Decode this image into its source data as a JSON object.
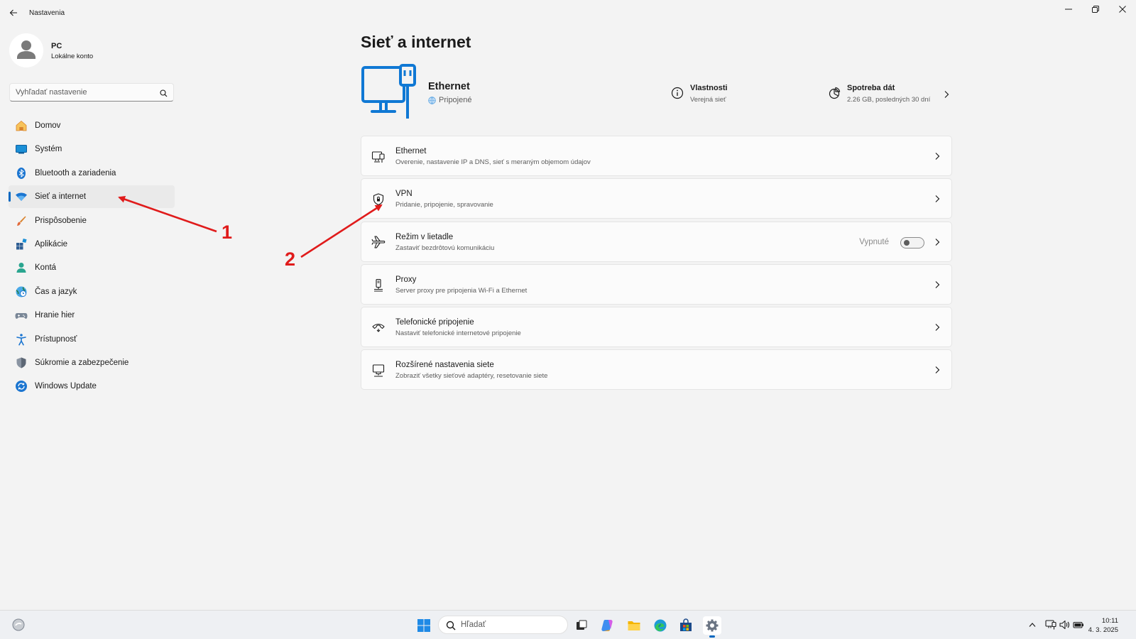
{
  "window": {
    "title": "Nastavenia",
    "controls": [
      "minimize",
      "restore",
      "close"
    ]
  },
  "profile": {
    "name": "PC",
    "account_type": "Lokálne konto"
  },
  "search": {
    "placeholder": "Vyhľadať nastavenie"
  },
  "sidebar": {
    "items": [
      {
        "label": "Domov",
        "icon": "home-icon",
        "active": false
      },
      {
        "label": "Systém",
        "icon": "system-icon",
        "active": false
      },
      {
        "label": "Bluetooth a zariadenia",
        "icon": "bluetooth-icon",
        "active": false
      },
      {
        "label": "Sieť a internet",
        "icon": "wifi-icon",
        "active": true
      },
      {
        "label": "Prispôsobenie",
        "icon": "brush-icon",
        "active": false
      },
      {
        "label": "Aplikácie",
        "icon": "apps-icon",
        "active": false
      },
      {
        "label": "Kontá",
        "icon": "account-icon",
        "active": false
      },
      {
        "label": "Čas a jazyk",
        "icon": "time-language-icon",
        "active": false
      },
      {
        "label": "Hranie hier",
        "icon": "gamepad-icon",
        "active": false
      },
      {
        "label": "Prístupnosť",
        "icon": "accessibility-icon",
        "active": false
      },
      {
        "label": "Súkromie a zabezpečenie",
        "icon": "shield-icon",
        "active": false
      },
      {
        "label": "Windows Update",
        "icon": "update-icon",
        "active": false
      }
    ]
  },
  "main": {
    "title": "Sieť a internet",
    "hero": {
      "name": "Ethernet",
      "status": "Pripojené",
      "properties_title": "Vlastnosti",
      "properties_sub": "Verejná sieť",
      "data_title": "Spotreba dát",
      "data_sub": "2.26 GB, posledných 30 dní"
    },
    "cards": [
      {
        "title": "Ethernet",
        "subtitle": "Overenie, nastavenie IP a DNS, sieť s meraným objemom údajov",
        "icon": "ethernet-icon"
      },
      {
        "title": "VPN",
        "subtitle": "Pridanie, pripojenie, spravovanie",
        "icon": "vpn-shield-icon"
      },
      {
        "title": "Režim v lietadle",
        "subtitle": "Zastaviť bezdrôtovú komunikáciu",
        "icon": "airplane-icon",
        "toggle_text": "Vypnuté",
        "toggle_on": false
      },
      {
        "title": "Proxy",
        "subtitle": "Server proxy pre pripojenia Wi-Fi a Ethernet",
        "icon": "proxy-icon"
      },
      {
        "title": "Telefonické pripojenie",
        "subtitle": "Nastaviť telefonické internetové pripojenie",
        "icon": "dialup-icon"
      },
      {
        "title": "Rozšírené nastavenia siete",
        "subtitle": "Zobraziť všetky sieťové adaptéry, resetovanie siete",
        "icon": "advanced-network-icon"
      }
    ]
  },
  "annotations": {
    "label_1": "1",
    "label_2": "2",
    "color": "#e01b1b"
  },
  "taskbar": {
    "search_placeholder": "Hľadať",
    "apps": [
      "start-icon",
      "task-view-icon",
      "copilot-icon",
      "file-explorer-icon",
      "edge-icon",
      "store-icon",
      "settings-icon"
    ],
    "time": "10:11",
    "date": "4. 3. 2025"
  },
  "colors": {
    "accent": "#0067c0",
    "background": "#f3f3f3",
    "card": "#fbfbfb"
  }
}
